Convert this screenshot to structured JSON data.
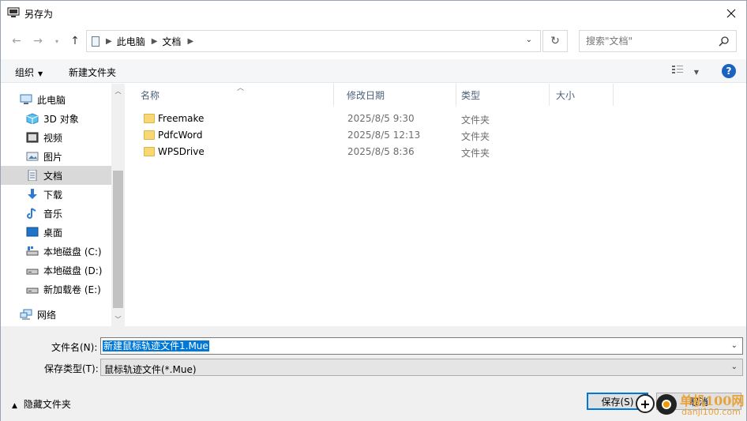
{
  "window": {
    "title": "另存为"
  },
  "address": {
    "breadcrumbs": [
      "此电脑",
      "文档"
    ]
  },
  "search": {
    "placeholder": "搜索\"文档\""
  },
  "toolbar": {
    "organize_label": "组织",
    "new_folder_label": "新建文件夹"
  },
  "nav": {
    "items": [
      {
        "label": "此电脑",
        "icon": "computer-icon"
      },
      {
        "label": "3D 对象",
        "icon": "3d-objects-icon"
      },
      {
        "label": "视频",
        "icon": "video-icon"
      },
      {
        "label": "图片",
        "icon": "pictures-icon"
      },
      {
        "label": "文档",
        "icon": "documents-icon",
        "selected": true
      },
      {
        "label": "下载",
        "icon": "download-icon"
      },
      {
        "label": "音乐",
        "icon": "music-icon"
      },
      {
        "label": "桌面",
        "icon": "desktop-icon"
      },
      {
        "label": "本地磁盘 (C:)",
        "icon": "drive-icon"
      },
      {
        "label": "本地磁盘 (D:)",
        "icon": "drive-icon"
      },
      {
        "label": "新加载卷 (E:)",
        "icon": "drive-icon"
      },
      {
        "label": "网络",
        "icon": "network-icon"
      }
    ]
  },
  "columns": {
    "name": "名称",
    "modified": "修改日期",
    "type": "类型",
    "size": "大小"
  },
  "files": [
    {
      "name": "Freemake",
      "modified": "2025/8/5 9:30",
      "type": "文件夹"
    },
    {
      "name": "PdfcWord",
      "modified": "2025/8/5 12:13",
      "type": "文件夹"
    },
    {
      "name": "WPSDrive",
      "modified": "2025/8/5 8:36",
      "type": "文件夹"
    }
  ],
  "save": {
    "filename_label": "文件名(N):",
    "filename_value": "新建鼠标轨迹文件1.Mue",
    "filetype_label": "保存类型(T):",
    "filetype_value": "鼠标轨迹文件(*.Mue)",
    "hide_folders_label": "隐藏文件夹",
    "save_button": "保存(S)",
    "cancel_button": "取消"
  },
  "watermark": {
    "text1": "单机100网",
    "text2": "danji100.com"
  },
  "colors": {
    "accent": "#0078d7",
    "selection": "#d9d9d9",
    "help": "#1a63c0"
  }
}
